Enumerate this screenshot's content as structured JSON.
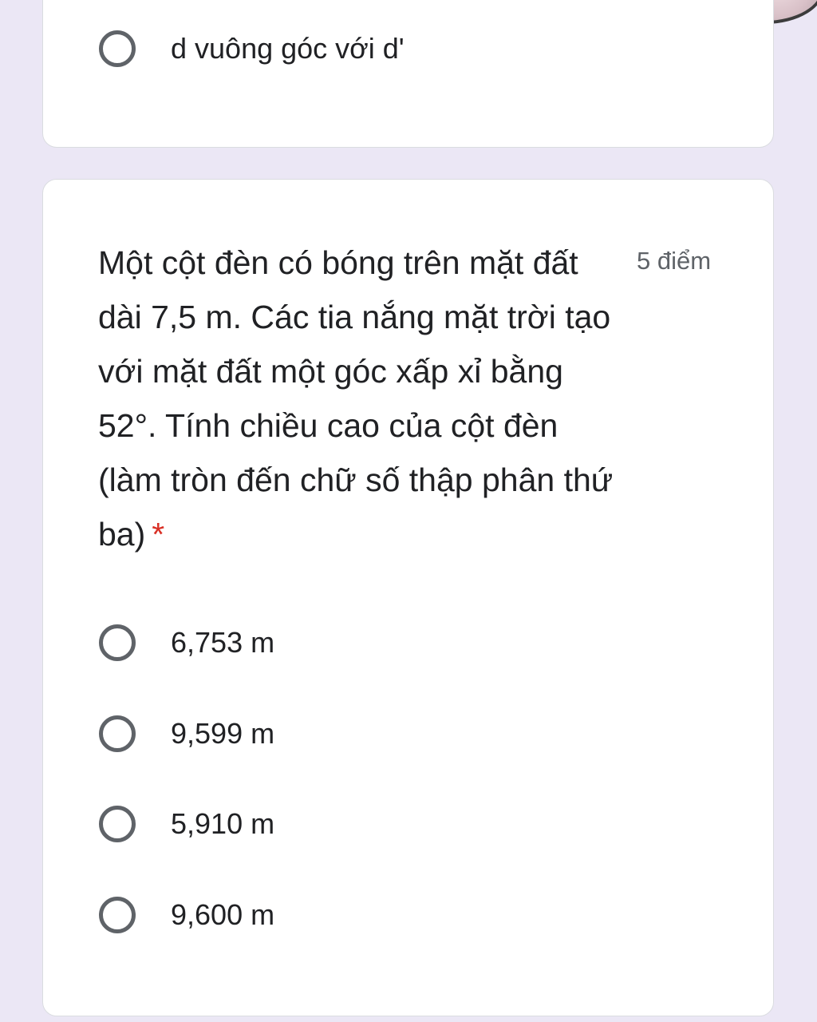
{
  "previous_question": {
    "options": [
      {
        "label": "d vuông góc với d'"
      }
    ]
  },
  "question": {
    "text": "Một cột đèn có bóng trên mặt đất dài 7,5 m. Các tia nắng mặt trời tạo với mặt đất một góc xấp xỉ bằng 52°. Tính chiều cao của cột đèn (làm tròn đến chữ số thập phân thứ ba)",
    "required_marker": "*",
    "points": "5 điểm",
    "options": [
      {
        "label": "6,753 m"
      },
      {
        "label": "9,599 m"
      },
      {
        "label": "5,910 m"
      },
      {
        "label": "9,600 m"
      }
    ]
  },
  "colors": {
    "page_background": "#ebe7f5",
    "card_background": "#ffffff",
    "radio_border": "#5f6368",
    "required_star": "#d93025",
    "points_text": "#5f6368"
  },
  "icons": {
    "radio": "radio-unchecked-icon",
    "avatar": "user-avatar"
  }
}
